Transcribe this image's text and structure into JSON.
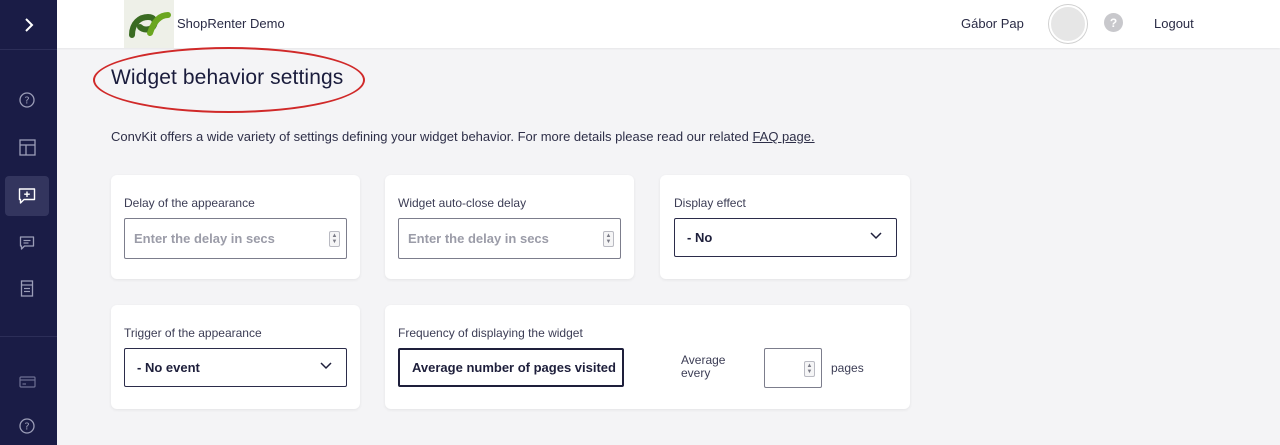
{
  "sidebar": {
    "items": [
      {
        "icon": "help-circle-icon"
      },
      {
        "icon": "layout-icon"
      },
      {
        "icon": "message-plus-icon",
        "active": true
      },
      {
        "icon": "chat-icon"
      },
      {
        "icon": "document-icon"
      },
      {
        "icon": "credit-card-icon"
      },
      {
        "icon": "help-circle-icon"
      }
    ]
  },
  "header": {
    "shop_name": "ShopRenter Demo",
    "user_name": "Gábor Pap",
    "help_symbol": "?",
    "logout_label": "Logout"
  },
  "page": {
    "title": "Widget behavior settings",
    "intro_text": "ConvKit offers a wide variety of settings defining your widget behavior. For more details please read our related ",
    "faq_link": "FAQ page.",
    "accent_color": "#d02929"
  },
  "fields": {
    "delay": {
      "label": "Delay of the appearance",
      "placeholder": "Enter the delay in secs"
    },
    "auto_close": {
      "label": "Widget auto-close delay",
      "placeholder": "Enter the delay in secs"
    },
    "display_effect": {
      "label": "Display effect",
      "value": "- No"
    },
    "trigger": {
      "label": "Trigger of the appearance",
      "value": "- No event"
    },
    "frequency": {
      "label": "Frequency of displaying the widget",
      "value": "Average number of pages visited",
      "avg_label_line1": "Average",
      "avg_label_line2": "every",
      "pages_value": "",
      "pages_label": "pages"
    }
  }
}
